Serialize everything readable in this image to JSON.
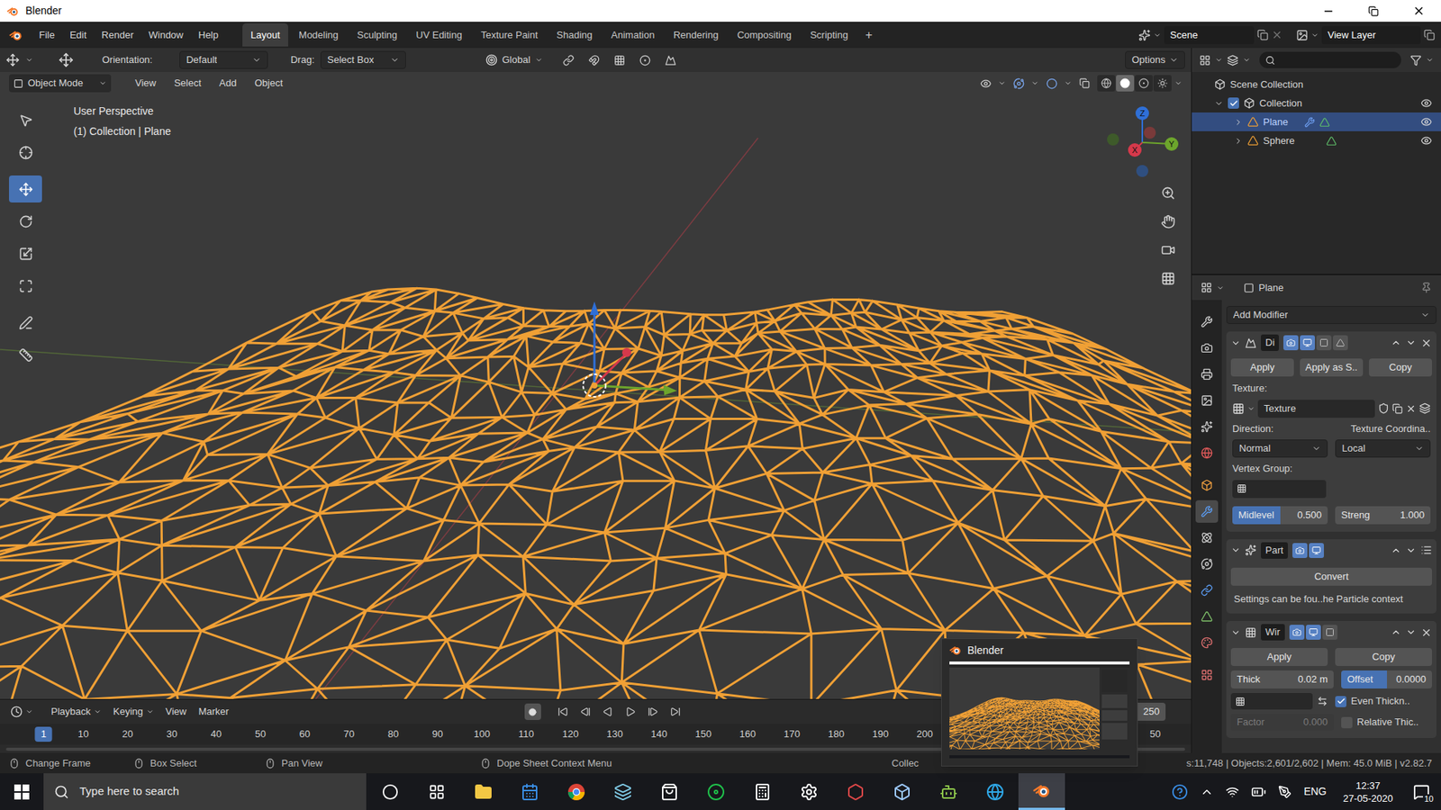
{
  "window": {
    "title": "Blender"
  },
  "menu": [
    "File",
    "Edit",
    "Render",
    "Window",
    "Help"
  ],
  "workspaces": [
    {
      "label": "Layout",
      "selected": true
    },
    {
      "label": "Modeling",
      "selected": false
    },
    {
      "label": "Sculpting",
      "selected": false
    },
    {
      "label": "UV Editing",
      "selected": false
    },
    {
      "label": "Texture Paint",
      "selected": false
    },
    {
      "label": "Shading",
      "selected": false
    },
    {
      "label": "Animation",
      "selected": false
    },
    {
      "label": "Rendering",
      "selected": false
    },
    {
      "label": "Compositing",
      "selected": false
    },
    {
      "label": "Scripting",
      "selected": false
    }
  ],
  "add_workspace": "+",
  "scene": "Scene",
  "view_layer": "View Layer",
  "tool_header": {
    "orientation_label": "Orientation:",
    "orientation": "Default",
    "drag_label": "Drag:",
    "drag": "Select Box",
    "transform_orientation": "Global",
    "options": "Options"
  },
  "view_header": {
    "mode": "Object Mode",
    "menus": [
      "View",
      "Select",
      "Add",
      "Object"
    ],
    "shading": [
      {
        "selected": false
      },
      {
        "selected": true
      },
      {
        "selected": false
      },
      {
        "selected": false
      }
    ]
  },
  "viewport": {
    "perspective": "User Perspective",
    "context": "(1) Collection | Plane",
    "axes": [
      {
        "label": "Z",
        "color": "#2f6fd6"
      },
      {
        "label": "Y",
        "color": "#6da52c"
      },
      {
        "label": "X",
        "color": "#d6394b"
      }
    ]
  },
  "toolbar": [
    {
      "selected": false
    },
    {
      "selected": false
    },
    {
      "selected": true
    },
    {
      "selected": false
    },
    {
      "selected": false
    },
    {
      "selected": false
    },
    {
      "selected": false
    },
    {
      "selected": false
    }
  ],
  "outliner": {
    "rows": [
      {
        "label": "Scene Collection",
        "depth": 0,
        "kind": "scene",
        "expanded": true,
        "checked": false,
        "visible": false,
        "selected": false,
        "modifiers": false
      },
      {
        "label": "Collection",
        "depth": 1,
        "kind": "collection",
        "expanded": true,
        "checked": true,
        "visible": true,
        "selected": false,
        "modifiers": false
      },
      {
        "label": "Plane",
        "depth": 2,
        "kind": "object",
        "expanded": false,
        "checked": false,
        "visible": true,
        "selected": true,
        "modifiers": true
      },
      {
        "label": "Sphere",
        "depth": 2,
        "kind": "object",
        "expanded": false,
        "checked": false,
        "visible": true,
        "selected": false,
        "modifiers": false
      }
    ]
  },
  "properties": {
    "object": "Plane",
    "add_modifier": "Add Modifier",
    "tabs": [
      {
        "selected": false
      },
      {
        "selected": false
      },
      {
        "selected": false
      },
      {
        "selected": false
      },
      {
        "selected": false
      },
      {
        "selected": false
      },
      {
        "selected": false
      },
      {
        "selected": true
      },
      {
        "selected": false
      },
      {
        "selected": false
      },
      {
        "selected": false
      },
      {
        "selected": false
      },
      {
        "selected": false
      },
      {
        "selected": false
      }
    ],
    "displace": {
      "name": "Di",
      "expanded": true,
      "toggles": [
        true,
        true,
        false,
        false
      ],
      "buttons": [
        "Apply",
        "Apply as S..",
        "Copy"
      ],
      "texture_label": "Texture:",
      "texture": "Texture",
      "direction_label": "Direction:",
      "coords": "Texture Coordina..",
      "direction": "Normal",
      "space": "Local",
      "vertex_group_label": "Vertex Group:",
      "fields": [
        {
          "label": "Midlevel",
          "value": "0.500",
          "level": 0.5
        },
        {
          "label": "Streng",
          "value": "1.000",
          "level": 0
        }
      ]
    },
    "particle": {
      "name": "Part",
      "expanded": true,
      "toggles": [
        true,
        true
      ],
      "button": "Convert",
      "note": "Settings can be fou..he Particle context"
    },
    "wireframe": {
      "name": "Wir",
      "expanded": true,
      "toggles": [
        true,
        true,
        false
      ],
      "buttons": [
        "Apply",
        "Copy"
      ],
      "thickness": {
        "label": "Thick",
        "value": "0.02 m"
      },
      "offset": {
        "label": "Offset",
        "value": "0.0000",
        "level": 0.5
      },
      "even": {
        "label": "Even Thickn..",
        "checked": true
      },
      "factor": {
        "label": "Factor",
        "value": "0.000",
        "disabled": true
      },
      "relative": {
        "label": "Relative Thic..",
        "checked": false
      }
    }
  },
  "timeline": {
    "menus": [
      "Playback",
      "Keying",
      "View",
      "Marker"
    ],
    "end_frame": "250",
    "ticks": [
      {
        "label": "1",
        "selected": true
      },
      {
        "label": "10",
        "selected": false
      },
      {
        "label": "20",
        "selected": false
      },
      {
        "label": "30",
        "selected": false
      },
      {
        "label": "40",
        "selected": false
      },
      {
        "label": "50",
        "selected": false
      },
      {
        "label": "60",
        "selected": false
      },
      {
        "label": "70",
        "selected": false
      },
      {
        "label": "80",
        "selected": false
      },
      {
        "label": "90",
        "selected": false
      },
      {
        "label": "100",
        "selected": false
      },
      {
        "label": "110",
        "selected": false
      },
      {
        "label": "120",
        "selected": false
      },
      {
        "label": "130",
        "selected": false
      },
      {
        "label": "140",
        "selected": false
      },
      {
        "label": "150",
        "selected": false
      },
      {
        "label": "160",
        "selected": false
      },
      {
        "label": "170",
        "selected": false
      },
      {
        "label": "180",
        "selected": false
      },
      {
        "label": "190",
        "selected": false
      },
      {
        "label": "200",
        "selected": false
      }
    ],
    "cut_tick": "50"
  },
  "status": {
    "items": [
      "Change Frame",
      "Box Select",
      "Pan View",
      "Dope Sheet Context Menu"
    ],
    "collection": "Collec",
    "stats": "s:11,748 | Objects:2,601/2,602 | Mem: 45.0 MiB | v2.82.7"
  },
  "taskbar": {
    "search": "Type here to search",
    "apps": [
      {
        "selected": false
      },
      {
        "selected": false
      },
      {
        "selected": false
      },
      {
        "selected": false
      },
      {
        "selected": false
      },
      {
        "selected": false
      },
      {
        "selected": false
      },
      {
        "selected": false
      },
      {
        "selected": false
      },
      {
        "selected": false
      },
      {
        "selected": false
      },
      {
        "selected": false
      },
      {
        "selected": false
      },
      {
        "selected": false
      },
      {
        "selected": true
      }
    ],
    "language": "ENG",
    "time": "12:37",
    "date": "27-05-2020",
    "notifications": "10"
  },
  "preview": {
    "title": "Blender"
  }
}
